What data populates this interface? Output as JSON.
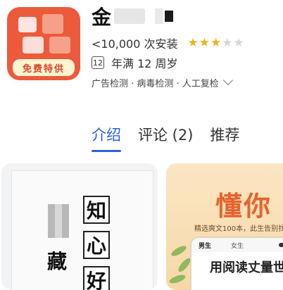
{
  "app": {
    "icon_banner": "免费特供",
    "title": "金",
    "installs": "<10,000 次安装",
    "rating": {
      "filled": 3,
      "total": 5
    },
    "age_badge": "12",
    "age_text": "年满 12 周岁",
    "checks": "广告检测 · 病毒检测 · 人工复检"
  },
  "tabs": [
    "介绍",
    "评论 (2)",
    "推荐"
  ],
  "screenshots": {
    "one": {
      "right_column": [
        "知",
        "心",
        "好"
      ],
      "left_column": [
        "藏"
      ]
    },
    "two": {
      "title": "懂你",
      "subtitle": "精选爽文100本，此生告别找书",
      "phone_tabs": [
        "男生",
        "女生"
      ],
      "phone_headline": "用阅读丈量世界"
    }
  },
  "colors": {
    "accent": "#2a62d8",
    "brand": "#ec5a3b",
    "star": "#f1b21b"
  }
}
